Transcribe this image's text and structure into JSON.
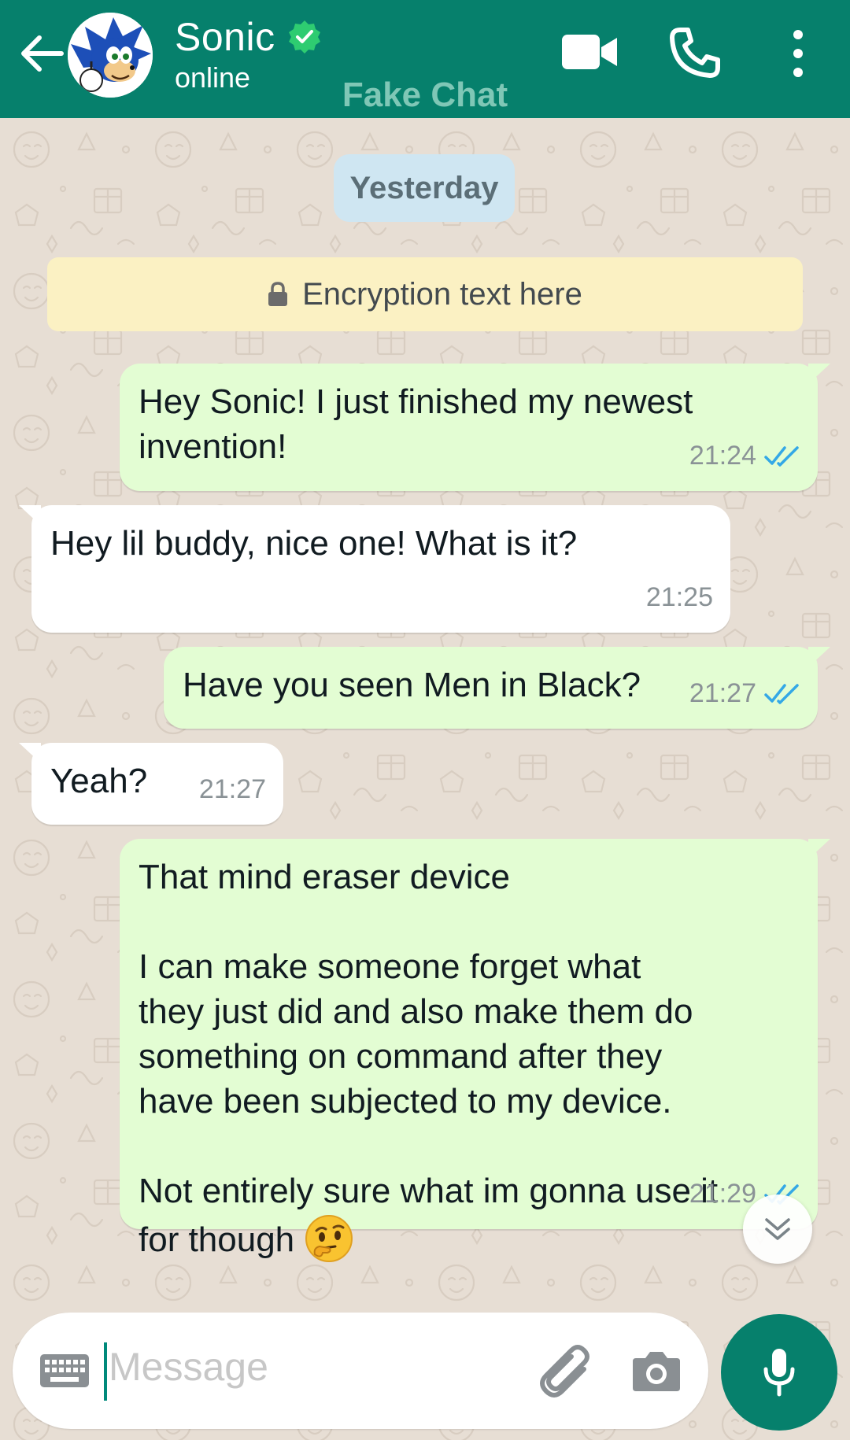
{
  "header": {
    "contact_name": "Sonic",
    "status": "online",
    "watermark": "Fake Chat"
  },
  "chat": {
    "date_label": "Yesterday",
    "encryption_text": "Encryption text here",
    "messages": [
      {
        "direction": "outgoing",
        "text": "Hey Sonic! I just finished my newest\ninvention!",
        "time": "21:24",
        "read": true
      },
      {
        "direction": "incoming",
        "text": "Hey lil buddy, nice one! What is it?",
        "time": "21:25"
      },
      {
        "direction": "outgoing",
        "text": "Have you seen Men in Black?",
        "time": "21:27",
        "read": true
      },
      {
        "direction": "incoming",
        "text": "Yeah?",
        "time": "21:27"
      },
      {
        "direction": "outgoing",
        "text": "That mind eraser device\n\nI can make someone forget what\nthey just did and also make them do\nsomething on command after they\nhave been subjected to my device.\n\nNot entirely sure what im gonna use it\nfor though",
        "emoji": "thinking-face",
        "time": "21:29",
        "read": true
      }
    ]
  },
  "input": {
    "placeholder": "Message"
  },
  "icons": {
    "back": "arrow-left-icon",
    "verified": "verified-badge-icon",
    "video": "video-camera-icon",
    "call": "phone-icon",
    "more": "more-vertical-icon",
    "lock": "lock-icon",
    "read_receipt": "double-check-icon",
    "scroll_down": "chevron-double-down-icon",
    "keyboard": "keyboard-icon",
    "attach": "paperclip-icon",
    "camera": "camera-icon",
    "mic": "microphone-icon"
  },
  "colors": {
    "header_bg": "#06806c",
    "outgoing_bubble": "#e3fdd3",
    "incoming_bubble": "#ffffff",
    "read_tick": "#34a8e6",
    "chat_bg": "#e7ded4",
    "date_pill": "#cfe6f2",
    "encryption_banner": "#fbf1c3"
  }
}
